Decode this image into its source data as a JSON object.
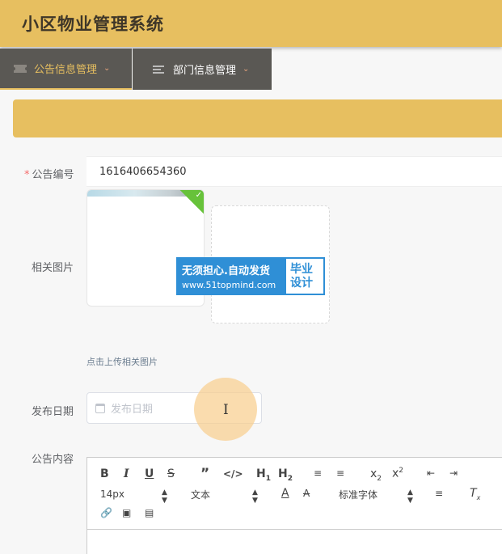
{
  "header": {
    "title": "小区物业管理系统"
  },
  "nav": [
    {
      "label": "公告信息管理",
      "icon": "ticket-icon"
    },
    {
      "label": "部门信息管理",
      "icon": "list-icon"
    }
  ],
  "form": {
    "number_label": "公告编号",
    "number_value": "1616406654360",
    "image_label": "相关图片",
    "upload_hint": "点击上传相关图片",
    "date_label": "发布日期",
    "date_placeholder": "发布日期",
    "content_label": "公告内容"
  },
  "watermark": {
    "line1": "无须担心.自动发货",
    "line2": "www.51topmind.com",
    "right1": "毕业",
    "right2": "设计"
  },
  "editor": {
    "font_size": "14px",
    "header_select": "文本",
    "font_family": "标准字体",
    "buttons": [
      "bold",
      "italic",
      "underline",
      "strike",
      "blockquote",
      "code-block",
      "h1",
      "h2",
      "ordered-list",
      "bullet-list",
      "subscript",
      "superscript",
      "outdent",
      "indent",
      "font-color",
      "background",
      "align",
      "clean",
      "link",
      "image",
      "video"
    ]
  },
  "colors": {
    "accent": "#e7bf60",
    "nav_bg": "#5a5854",
    "required": "#f56c6c"
  }
}
